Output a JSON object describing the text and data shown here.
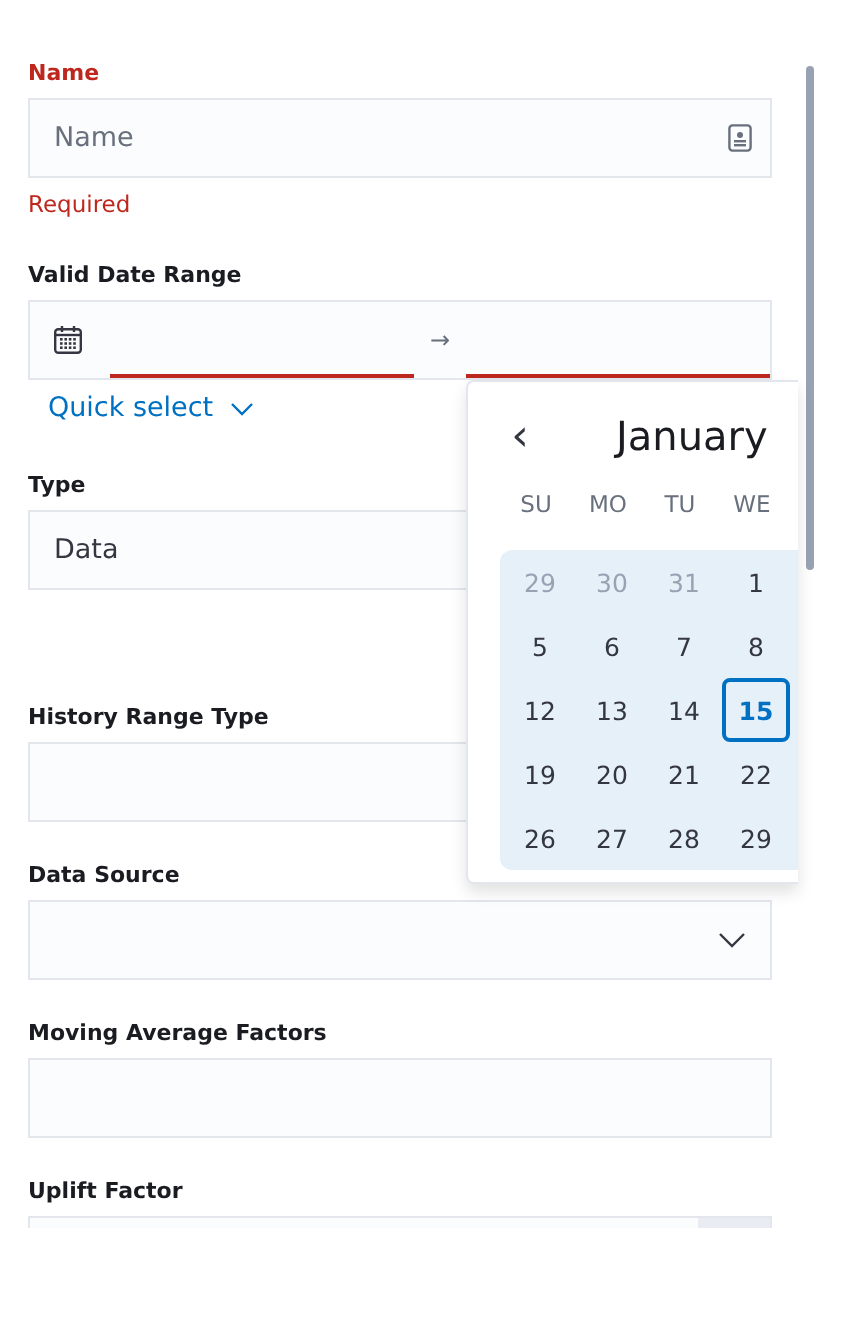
{
  "name_field": {
    "label": "Name",
    "placeholder": "Name",
    "invalid": true,
    "error": "Required"
  },
  "date_range": {
    "label": "Valid Date Range",
    "arrow": "→",
    "start_invalid": true,
    "end_invalid": true,
    "quick_select": "Quick select"
  },
  "type_field": {
    "label": "Type",
    "value": "Data"
  },
  "history_range_type": {
    "label": "History Range Type"
  },
  "data_source": {
    "label": "Data Source"
  },
  "moving_average_factors": {
    "label": "Moving Average Factors"
  },
  "uplift_factor": {
    "label": "Uplift Factor"
  },
  "calendar": {
    "prev": "‹",
    "month": "January",
    "weekdays": [
      "SU",
      "MO",
      "TU",
      "WE"
    ],
    "days": [
      {
        "label": "29",
        "outside": true,
        "selected": false
      },
      {
        "label": "30",
        "outside": true,
        "selected": false
      },
      {
        "label": "31",
        "outside": true,
        "selected": false
      },
      {
        "label": "1",
        "outside": false,
        "selected": false
      },
      {
        "label": "5",
        "outside": false,
        "selected": false
      },
      {
        "label": "6",
        "outside": false,
        "selected": false
      },
      {
        "label": "7",
        "outside": false,
        "selected": false
      },
      {
        "label": "8",
        "outside": false,
        "selected": false
      },
      {
        "label": "12",
        "outside": false,
        "selected": false
      },
      {
        "label": "13",
        "outside": false,
        "selected": false
      },
      {
        "label": "14",
        "outside": false,
        "selected": false
      },
      {
        "label": "15",
        "outside": false,
        "selected": true
      },
      {
        "label": "19",
        "outside": false,
        "selected": false
      },
      {
        "label": "20",
        "outside": false,
        "selected": false
      },
      {
        "label": "21",
        "outside": false,
        "selected": false
      },
      {
        "label": "22",
        "outside": false,
        "selected": false
      },
      {
        "label": "26",
        "outside": false,
        "selected": false
      },
      {
        "label": "27",
        "outside": false,
        "selected": false
      },
      {
        "label": "28",
        "outside": false,
        "selected": false
      },
      {
        "label": "29",
        "outside": false,
        "selected": false
      }
    ]
  }
}
